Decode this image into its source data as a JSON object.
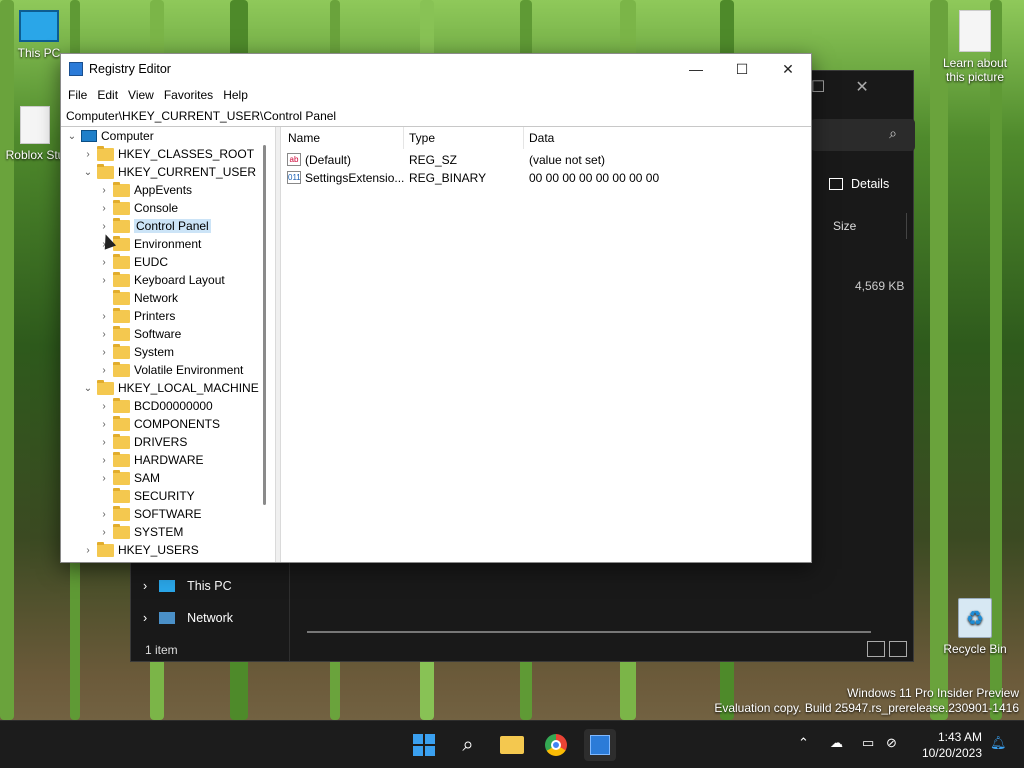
{
  "desktop": {
    "icons": [
      {
        "label": "This PC"
      },
      {
        "label": "Roblox Stu"
      },
      {
        "label": "Learn about this picture"
      },
      {
        "label": "Recycle Bin"
      }
    ],
    "watermark": {
      "line1": "Windows 11 Pro Insider Preview",
      "line2": "Evaluation copy. Build 25947.rs_prerelease.230901-1416"
    }
  },
  "explorer": {
    "details_label": "Details",
    "size_column": "Size",
    "size_value": "4,569 KB",
    "nav_items": [
      {
        "label": "This PC"
      },
      {
        "label": "Network"
      }
    ],
    "status": "1 item"
  },
  "regedit": {
    "title": "Registry Editor",
    "menu": [
      "File",
      "Edit",
      "View",
      "Favorites",
      "Help"
    ],
    "address": "Computer\\HKEY_CURRENT_USER\\Control Panel",
    "tree": [
      {
        "label": "Computer"
      },
      {
        "label": "HKEY_CLASSES_ROOT"
      },
      {
        "label": "HKEY_CURRENT_USER"
      },
      {
        "label": "AppEvents"
      },
      {
        "label": "Console"
      },
      {
        "label": "Control Panel"
      },
      {
        "label": "Environment"
      },
      {
        "label": "EUDC"
      },
      {
        "label": "Keyboard Layout"
      },
      {
        "label": "Network"
      },
      {
        "label": "Printers"
      },
      {
        "label": "Software"
      },
      {
        "label": "System"
      },
      {
        "label": "Volatile Environment"
      },
      {
        "label": "HKEY_LOCAL_MACHINE"
      },
      {
        "label": "BCD00000000"
      },
      {
        "label": "COMPONENTS"
      },
      {
        "label": "DRIVERS"
      },
      {
        "label": "HARDWARE"
      },
      {
        "label": "SAM"
      },
      {
        "label": "SECURITY"
      },
      {
        "label": "SOFTWARE"
      },
      {
        "label": "SYSTEM"
      },
      {
        "label": "HKEY_USERS"
      }
    ],
    "columns": {
      "name": "Name",
      "type": "Type",
      "data": "Data"
    },
    "values": [
      {
        "name": "(Default)",
        "type": "REG_SZ",
        "data": "(value not set)",
        "icon": "ab"
      },
      {
        "name": "SettingsExtensio...",
        "type": "REG_BINARY",
        "data": "00 00 00 00 00 00 00 00",
        "icon": "011"
      }
    ]
  },
  "taskbar": {
    "time": "1:43 AM",
    "date": "10/20/2023"
  }
}
